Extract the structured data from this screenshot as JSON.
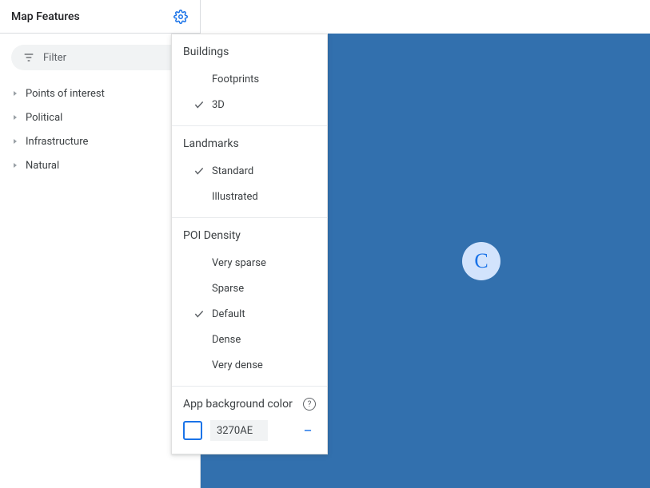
{
  "sidebar": {
    "title": "Map Features",
    "filter_label": "Filter",
    "tree": [
      {
        "label": "Points of interest"
      },
      {
        "label": "Political"
      },
      {
        "label": "Infrastructure"
      },
      {
        "label": "Natural"
      }
    ]
  },
  "settings_panel": {
    "sections": [
      {
        "title": "Buildings",
        "options": [
          {
            "label": "Footprints",
            "selected": false
          },
          {
            "label": "3D",
            "selected": true
          }
        ]
      },
      {
        "title": "Landmarks",
        "options": [
          {
            "label": "Standard",
            "selected": true
          },
          {
            "label": "Illustrated",
            "selected": false
          }
        ]
      },
      {
        "title": "POI Density",
        "options": [
          {
            "label": "Very sparse",
            "selected": false
          },
          {
            "label": "Sparse",
            "selected": false
          },
          {
            "label": "Default",
            "selected": true
          },
          {
            "label": "Dense",
            "selected": false
          },
          {
            "label": "Very dense",
            "selected": false
          }
        ]
      }
    ],
    "bgcolor": {
      "title": "App background color",
      "hex": "3270AE",
      "color": "#3270AE"
    }
  },
  "map": {
    "background_color": "#3270AE",
    "marker_letter": "C"
  }
}
